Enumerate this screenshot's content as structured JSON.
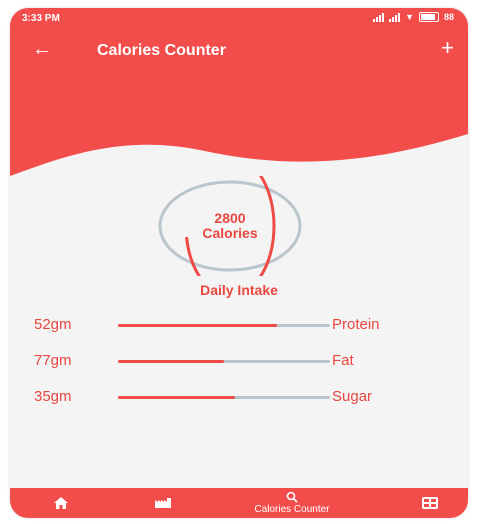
{
  "status_bar": {
    "time": "3:33 PM",
    "battery": "88"
  },
  "app_bar": {
    "title": "Calories Counter"
  },
  "calories": {
    "value": "2800",
    "unit": "Calories",
    "progress_fraction": 0.72
  },
  "daily_intake": {
    "title": "Daily Intake",
    "items": [
      {
        "amount": "52gm",
        "name": "Protein",
        "progress_fraction": 0.75
      },
      {
        "amount": "77gm",
        "name": "Fat",
        "progress_fraction": 0.5
      },
      {
        "amount": "35gm",
        "name": "Sugar",
        "progress_fraction": 0.55
      }
    ]
  },
  "bottom_nav": {
    "items": [
      {
        "icon": "home-icon"
      },
      {
        "icon": "factory-icon"
      },
      {
        "icon": "search-icon",
        "label": "Calories Counter"
      },
      {
        "icon": "grid-icon"
      }
    ]
  },
  "colors": {
    "primary": "#f24d4a",
    "accent_text": "#e9473f",
    "track": "#b9c6cc",
    "background": "#f4f4f4"
  }
}
